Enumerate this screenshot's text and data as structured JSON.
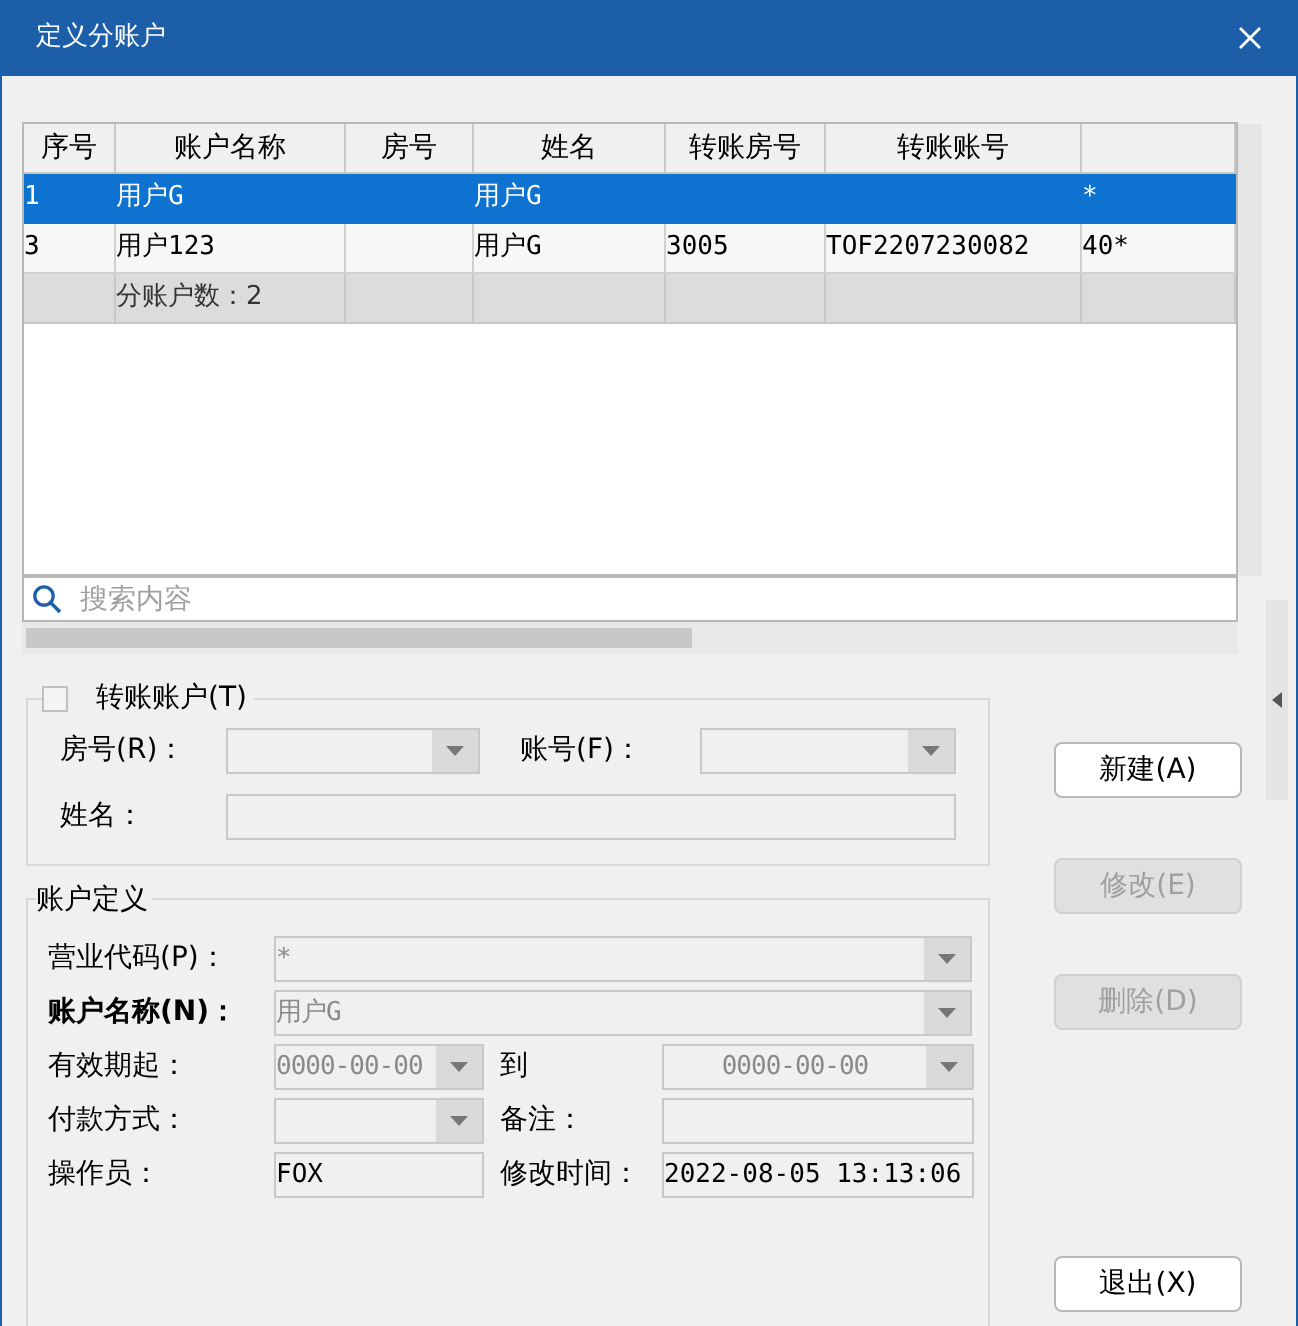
{
  "window": {
    "title": "定义分账户"
  },
  "table": {
    "columns": [
      "序号",
      "账户名称",
      "房号",
      "姓名",
      "转账房号",
      "转账账号",
      ""
    ],
    "rows": [
      {
        "selected": true,
        "cells": [
          "1",
          "用户G",
          "",
          "用户G",
          "",
          "",
          "*"
        ]
      },
      {
        "selected": false,
        "cells": [
          "3",
          "用户123",
          "",
          "用户G",
          "3005",
          "TOF2207230082",
          "40*"
        ]
      }
    ],
    "summary": "分账户数：2"
  },
  "search": {
    "placeholder": "搜索内容"
  },
  "transfer_group": {
    "label": "转账账户(T)",
    "checked": false,
    "room": {
      "label": "房号(R)："
    },
    "account": {
      "label": "账号(F)："
    },
    "name": {
      "label": "姓名："
    }
  },
  "account_group": {
    "title": "账户定义",
    "rows": [
      {
        "items": [
          {
            "kind": "wide-combo",
            "label": "营业代码(P)：",
            "value": "*",
            "bold": false
          }
        ]
      },
      {
        "items": [
          {
            "kind": "wide-combo",
            "label": "账户名称(N)：",
            "value": "用户G",
            "bold": true
          }
        ]
      },
      {
        "items": [
          {
            "kind": "combo",
            "label": "有效期起：",
            "value": "0000-00-00",
            "bold": false
          },
          {
            "kind": "combo",
            "label": "到",
            "value": "0000-00-00",
            "bold": false
          }
        ]
      },
      {
        "items": [
          {
            "kind": "combo",
            "label": "付款方式：",
            "bold": false
          },
          {
            "kind": "text",
            "label": "备注：",
            "bold": false
          }
        ]
      },
      {
        "items": [
          {
            "kind": "text",
            "label": "操作员：",
            "value": "FOX",
            "bold": false
          },
          {
            "kind": "text",
            "label": "修改时间：",
            "value": "2022-08-05 13:13:06",
            "bold": false
          }
        ]
      }
    ]
  },
  "buttons": [
    {
      "label": "新建(A)",
      "disabled": false
    },
    {
      "label": "修改(E)",
      "disabled": true
    },
    {
      "label": "删除(D)",
      "disabled": true
    },
    {
      "label": "退出(X)",
      "disabled": false
    }
  ]
}
